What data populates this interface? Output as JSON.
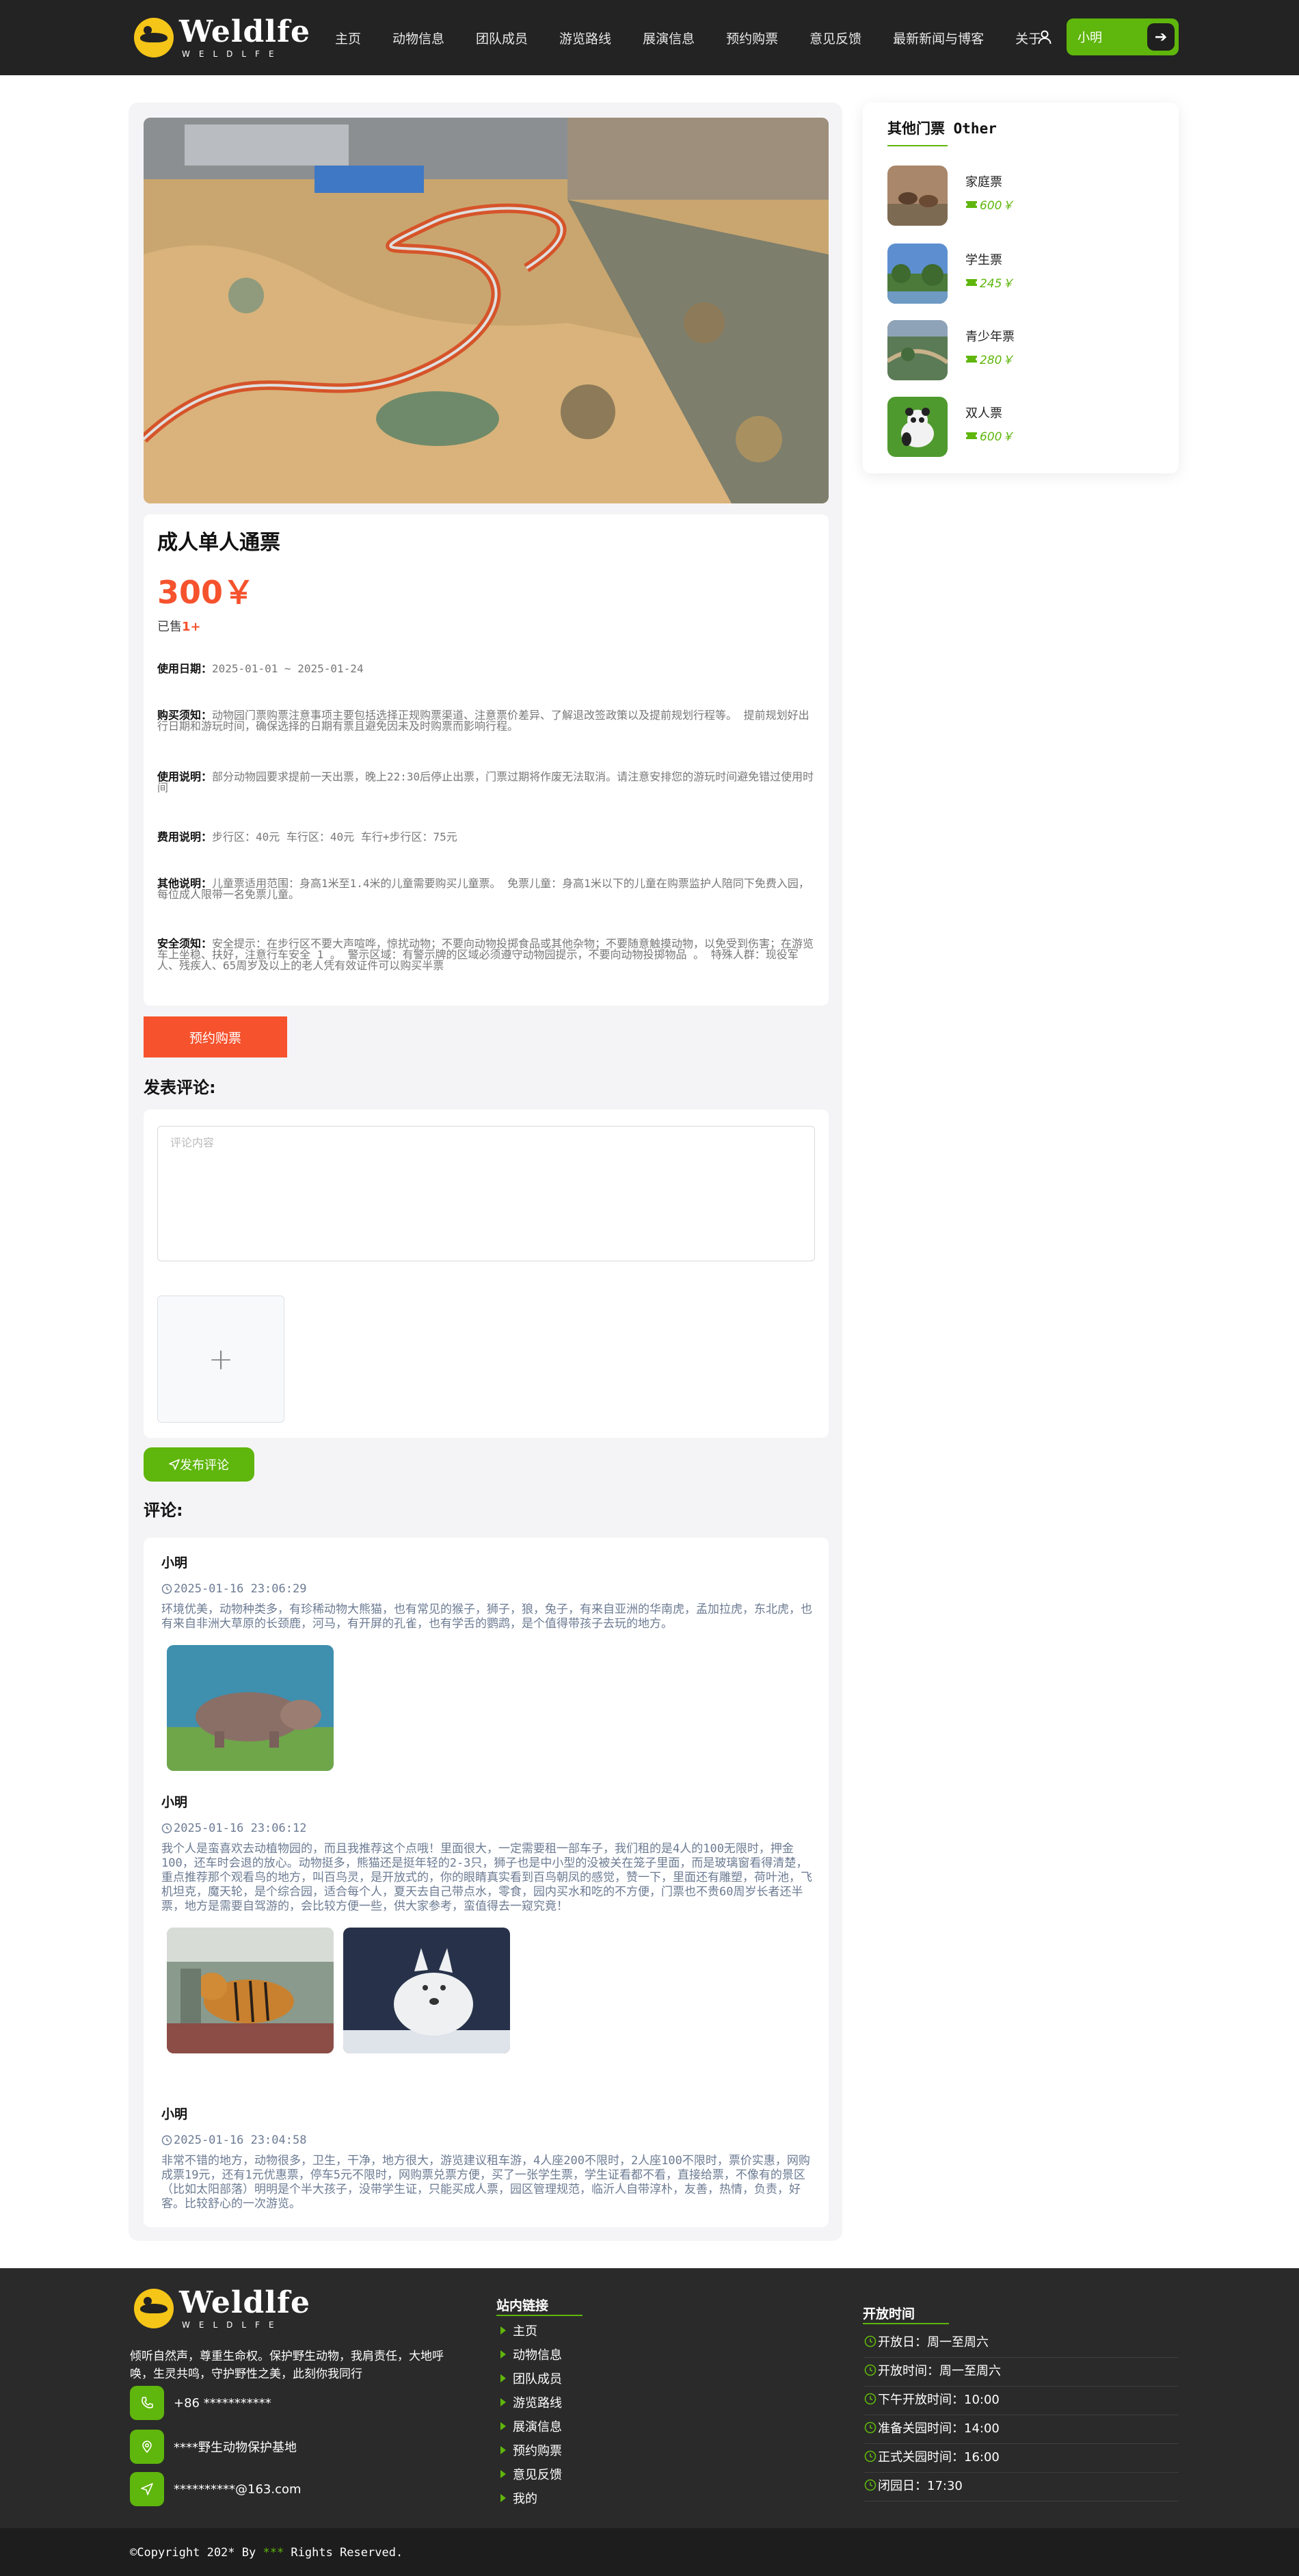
{
  "brand": {
    "name": "Weldlfe",
    "sub": "WELDLFE",
    "accent": "#5fb60c",
    "price_color": "#f5522d"
  },
  "nav": {
    "items": [
      "主页",
      "动物信息",
      "团队成员",
      "游览路线",
      "展演信息",
      "预约购票",
      "意见反馈",
      "最新新闻与博客",
      "关于"
    ],
    "user_name": "小明",
    "user_icon": "user-icon",
    "arrow_icon": "arrow-right-icon"
  },
  "ticket": {
    "title": "成人单人通票",
    "price": "300￥",
    "sold_label": "已售",
    "sold_count": "1+",
    "rows": [
      {
        "label": "使用日期：",
        "text": "2025-01-01 ~ 2025-01-24"
      },
      {
        "label": "购买须知：",
        "text": "动物园门票购票注意事项主要包括选择正规购票渠道、注意票价差异、了解退改签政策以及提前规划行程等。 提前规划好出行日期和游玩时间，确保选择的日期有票且避免因未及时购票而影响行程。"
      },
      {
        "label": "使用说明：",
        "text": "部分动物园要求提前一天出票，晚上22:30后停止出票，门票过期将作废无法取消。请注意安排您的游玩时间避免错过使用时间"
      },
      {
        "label": "费用说明：",
        "text": "步行区：40元 车行区：40元 车行+步行区：75元"
      },
      {
        "label": "其他说明：",
        "text": "儿童票适用范围：身高1米至1.4米的儿童需要购买儿童票。 免票儿童：身高1米以下的儿童在购票监护人陪同下免费入园，每位成人限带一名免票儿童。"
      },
      {
        "label": "安全须知：",
        "text": "安全提示：在步行区不要大声喧哗，惊扰动物；不要向动物投掷食品或其他杂物；不要随意触摸动物，以免受到伤害；在游览车上坐稳、扶好，注意行车安全 1 。 警示区域：有警示牌的区域必须遵守动物园提示，不要向动物投掷物品 。 特殊人群：现役军人、残疾人、65周岁及以上的老人凭有效证件可以购买半票"
      }
    ],
    "book_button": "预约购票"
  },
  "comment_form": {
    "heading": "发表评论:",
    "placeholder": "评论内容",
    "upload_icon": "plus-icon",
    "submit": "发布评论",
    "submit_icon": "send-icon"
  },
  "comments": {
    "heading": "评论:",
    "items": [
      {
        "user": "小明",
        "time": "2025-01-16 23:06:29",
        "text": "环境优美，动物种类多，有珍稀动物大熊猫，也有常见的猴子，狮子，狼，兔子，有来自亚洲的华南虎，孟加拉虎，东北虎，也有来自非洲大草原的长颈鹿，河马，有开屏的孔雀，也有学舌的鹦鹉，是个值得带孩子去玩的地方。",
        "photos": [
          "hippo-photo"
        ]
      },
      {
        "user": "小明",
        "time": "2025-01-16 23:06:12",
        "text": "我个人是蛮喜欢去动植物园的，而且我推荐这个点哦！里面很大，一定需要租一部车子，我们租的是4人的100无限时，押金100，还车时会退的放心。动物挺多，熊猫还是挺年轻的2-3只，狮子也是中小型的没被关在笼子里面，而是玻璃窗看得清楚，重点推荐那个观看鸟的地方，叫百鸟灵，是开放式的，你的眼睛真实看到百鸟朝凤的感觉，赞一下，里面还有雕塑，荷叶池，飞机坦克，魔天轮，是个综合园，适合每个人，夏天去自己带点水，零食，园内买水和吃的不方便，门票也不贵60周岁长者还半票，地方是需要自驾游的，会比较方便一些，供大家参考，蛮值得去一窥究竟！",
        "photos": [
          "tiger-photo",
          "wolf-photo"
        ]
      },
      {
        "user": "小明",
        "time": "2025-01-16 23:04:58",
        "text": "非常不错的地方，动物很多，卫生，干净，地方很大，游览建议租车游，4人座200不限时，2人座100不限时，票价实惠，网购成票19元，还有1元优惠票，停车5元不限时，网购票兑票方便，买了一张学生票，学生证看都不看，直接给票，不像有的景区（比如太阳部落）明明是个半大孩子，没带学生证，只能买成人票，园区管理规范，临沂人自带淳朴，友善，热情，负责，好客。比较舒心的一次游览。",
        "photos": []
      }
    ]
  },
  "sidebar": {
    "title": "其他门票 Other",
    "items": [
      {
        "name": "家庭票",
        "price": "600￥",
        "thumb": "deer-thumb"
      },
      {
        "name": "学生票",
        "price": "245￥",
        "thumb": "park-thumb"
      },
      {
        "name": "青少年票",
        "price": "280￥",
        "thumb": "aerial-thumb"
      },
      {
        "name": "双人票",
        "price": "600￥",
        "thumb": "panda-thumb"
      }
    ],
    "price_icon": "ticket-icon"
  },
  "footer": {
    "desc": "倾听自然声，尊重生命权。保护野生动物，我肩责任，大地呼唤，生灵共鸣，守护野性之美，此刻你我同行",
    "contacts": [
      {
        "icon": "phone-icon",
        "text": "+86 ***********"
      },
      {
        "icon": "location-icon",
        "text": "****野生动物保护基地"
      },
      {
        "icon": "send-icon",
        "text": "**********@163.com"
      }
    ],
    "links_heading": "站内链接",
    "links": [
      "主页",
      "动物信息",
      "团队成员",
      "游览路线",
      "展演信息",
      "预约购票",
      "意见反馈",
      "我的"
    ],
    "hours_heading": "开放时间",
    "hours": [
      "开放日：周一至周六",
      "开放时间：周一至周六",
      "下午开放时间：10:00",
      "准备关园时间：14:00",
      "正式关园时间：16:00",
      "闭园日：17:30"
    ],
    "copyright_prefix": "©Copyright 202* By ",
    "copyright_name": "***",
    "copyright_suffix": " Rights Reserved."
  }
}
